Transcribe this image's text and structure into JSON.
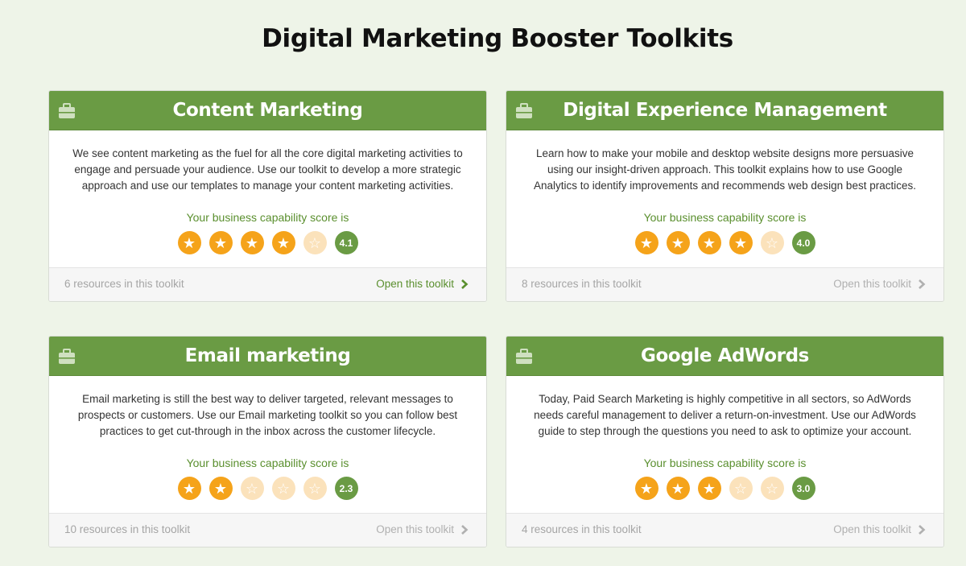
{
  "page": {
    "title": "Digital Marketing Booster Toolkits"
  },
  "cards": [
    {
      "title": "Content Marketing",
      "description": "We see content marketing as the fuel for all the core digital marketing activities to engage and persuade your audience. Use our toolkit to develop a more strategic approach and use our templates to manage your content marketing activities.",
      "score_label": "Your business capability score is",
      "score": "4.1",
      "stars_filled": 4,
      "stars_total": 5,
      "resources": "6 resources in this toolkit",
      "open_label": "Open this toolkit",
      "open_active": true
    },
    {
      "title": "Digital Experience Management",
      "description": "Learn how to make your mobile and desktop website designs more persuasive using our insight-driven approach. This toolkit explains how to use Google Analytics to identify improvements and recommends web design best practices.",
      "score_label": "Your business capability score is",
      "score": "4.0",
      "stars_filled": 4,
      "stars_total": 5,
      "resources": "8 resources in this toolkit",
      "open_label": "Open this toolkit",
      "open_active": false
    },
    {
      "title": "Email marketing",
      "description": "Email marketing is still the best way to deliver targeted, relevant messages to prospects or customers. Use our Email marketing toolkit so you can follow best practices to get cut-through in the inbox across the customer lifecycle.",
      "score_label": "Your business capability score is",
      "score": "2.3",
      "stars_filled": 2,
      "stars_total": 5,
      "resources": "10 resources in this toolkit",
      "open_label": "Open this toolkit",
      "open_active": false
    },
    {
      "title": "Google AdWords",
      "description": "Today, Paid Search Marketing is highly competitive in all sectors, so AdWords needs careful management to deliver a return-on-investment. Use our AdWords guide to step through the questions you need to ask to optimize your account.",
      "score_label": "Your business capability score is",
      "score": "3.0",
      "stars_filled": 3,
      "stars_total": 5,
      "resources": "4 resources in this toolkit",
      "open_label": "Open this toolkit",
      "open_active": false
    }
  ],
  "colors": {
    "header_green": "#6a9b44",
    "star_filled": "#f5a31a",
    "star_empty": "#fbe2bb",
    "link_active": "#5a8f2e",
    "link_inactive": "#b0b0b0"
  },
  "icons": {
    "card_icon": "briefcase-icon",
    "star_icon": "star-icon",
    "link_icon": "chevron-right-icon"
  }
}
